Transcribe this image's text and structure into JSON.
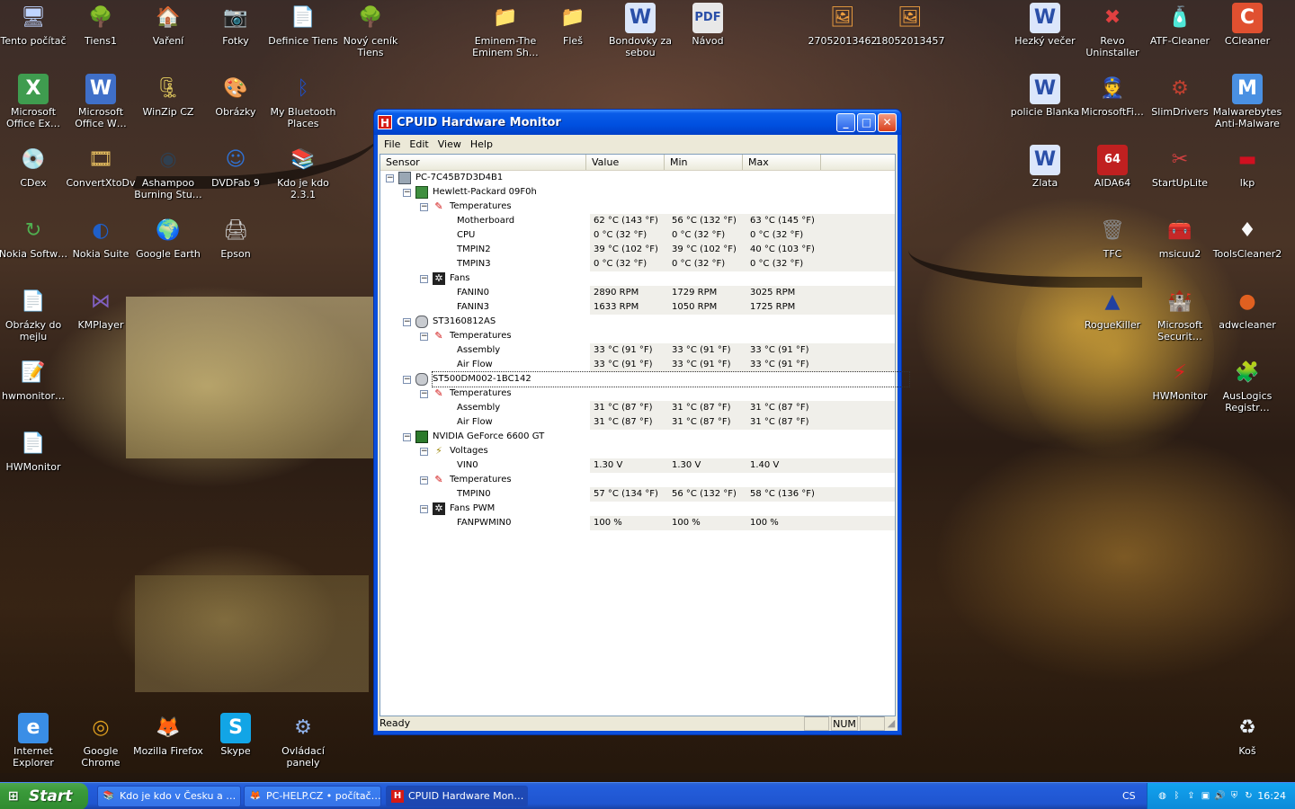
{
  "desktop": {
    "icons": [
      {
        "label": "Tento počítač",
        "icon": "computer-icon",
        "glyph": "🖥",
        "color": "#bfd4ff"
      },
      {
        "label": "Tiens1",
        "icon": "tree-icon",
        "glyph": "🌳",
        "color": "#3ea53e"
      },
      {
        "label": "Vaření",
        "icon": "home-folder-icon",
        "glyph": "🏠",
        "color": "#e8d7a0"
      },
      {
        "label": "Fotky",
        "icon": "camera-icon",
        "glyph": "📷",
        "color": "#c8c8c8"
      },
      {
        "label": "Definice Tiens",
        "icon": "document-icon",
        "glyph": "📄",
        "color": "#f2f2f2"
      },
      {
        "label": "Nový ceník Tiens",
        "icon": "tree-icon",
        "glyph": "🌳",
        "color": "#3ea53e"
      },
      {
        "label": "Eminem-The Eminem Sh…",
        "icon": "folder-icon",
        "glyph": "📁",
        "color": "#f3d370"
      },
      {
        "label": "Fleš",
        "icon": "folder-icon",
        "glyph": "📁",
        "color": "#f3d370"
      },
      {
        "label": "Bondovky za sebou",
        "icon": "word-document-icon",
        "glyph": "W",
        "color": "#dbe6fb"
      },
      {
        "label": "Návod",
        "icon": "pdf-icon",
        "glyph": "PDF",
        "color": "#e8e8e8"
      },
      {
        "label": "27052013462",
        "icon": "image-file-icon",
        "glyph": "🖼",
        "color": "#f0a040"
      },
      {
        "label": "18052013457",
        "icon": "image-file-icon",
        "glyph": "🖼",
        "color": "#f0a040"
      },
      {
        "label": "Hezký večer",
        "icon": "word-document-icon",
        "glyph": "W",
        "color": "#dbe6fb"
      },
      {
        "label": "Revo Uninstaller",
        "icon": "revo-uninstaller-icon",
        "glyph": "✖",
        "color": "#e04040"
      },
      {
        "label": "ATF-Cleaner",
        "icon": "atf-cleaner-icon",
        "glyph": "🧴",
        "color": "#8fb8f0"
      },
      {
        "label": "CCleaner",
        "icon": "ccleaner-icon",
        "glyph": "C",
        "color": "#e05030"
      },
      {
        "label": "Microsoft Office Ex…",
        "icon": "excel-icon",
        "glyph": "X",
        "color": "#3f9c4f"
      },
      {
        "label": "Microsoft Office W…",
        "icon": "word-icon",
        "glyph": "W",
        "color": "#3f6fc8"
      },
      {
        "label": "WinZip CZ",
        "icon": "winzip-icon",
        "glyph": "🗜",
        "color": "#e8d060"
      },
      {
        "label": "Obrázky",
        "icon": "pictures-icon",
        "glyph": "🎨",
        "color": "#d060c0"
      },
      {
        "label": "My Bluetooth Places",
        "icon": "bluetooth-icon",
        "glyph": "ᛒ",
        "color": "#1f4fc8"
      },
      {
        "label": "policie Blanka",
        "icon": "word-document-icon",
        "glyph": "W",
        "color": "#dbe6fb"
      },
      {
        "label": "MicrosoftFi…",
        "icon": "microsoft-fix-icon",
        "glyph": "👮",
        "color": "#4060a0"
      },
      {
        "label": "SlimDrivers",
        "icon": "slimdrivers-icon",
        "glyph": "⚙",
        "color": "#c04030"
      },
      {
        "label": "Malwarebytes Anti-Malware",
        "icon": "malwarebytes-icon",
        "glyph": "M",
        "color": "#4a90e2"
      },
      {
        "label": "CDex",
        "icon": "cdex-icon",
        "glyph": "💿",
        "color": "#c03030"
      },
      {
        "label": "ConvertXtoDv",
        "icon": "convertxtodvd-icon",
        "glyph": "🎞",
        "color": "#e8c060"
      },
      {
        "label": "Ashampoo Burning Stu…",
        "icon": "ashampoo-icon",
        "glyph": "◉",
        "color": "#304050"
      },
      {
        "label": "DVDFab 9",
        "icon": "dvdfab-icon",
        "glyph": "☺",
        "color": "#3070d0"
      },
      {
        "label": "Kdo je kdo 2.3.1",
        "icon": "books-icon",
        "glyph": "📚",
        "color": "#7050a0"
      },
      {
        "label": "Zlata",
        "icon": "word-document-icon",
        "glyph": "W",
        "color": "#dbe6fb"
      },
      {
        "label": "AIDA64",
        "icon": "aida64-icon",
        "glyph": "64",
        "color": "#c02020"
      },
      {
        "label": "StartUpLite",
        "icon": "startuplite-icon",
        "glyph": "✂",
        "color": "#d04040"
      },
      {
        "label": "lkp",
        "icon": "lkp-icon",
        "glyph": "▬",
        "color": "#d01020"
      },
      {
        "label": "Nokia Softw…",
        "icon": "nokia-software-icon",
        "glyph": "↻",
        "color": "#50b050"
      },
      {
        "label": "Nokia Suite",
        "icon": "nokia-suite-icon",
        "glyph": "◐",
        "color": "#1f5fc8"
      },
      {
        "label": "Google Earth",
        "icon": "google-earth-icon",
        "glyph": "🌍",
        "color": "#2a70d0"
      },
      {
        "label": "Epson",
        "icon": "printer-icon",
        "glyph": "🖨",
        "color": "#c8c8c8"
      },
      {
        "label": "TFC",
        "icon": "trash-can-icon",
        "glyph": "🗑",
        "color": "#888888"
      },
      {
        "label": "msicuu2",
        "icon": "msicuu-icon",
        "glyph": "🧰",
        "color": "#e0c060"
      },
      {
        "label": "ToolsCleaner2",
        "icon": "playing-card-icon",
        "glyph": "♦",
        "color": "#f8f8f8"
      },
      {
        "label": "Obrázky do mejlu",
        "icon": "document-icon",
        "glyph": "📄",
        "color": "#f2f2f2"
      },
      {
        "label": "KMPlayer",
        "icon": "kmplayer-icon",
        "glyph": "⋈",
        "color": "#8060c0"
      },
      {
        "label": "RogueKiller",
        "icon": "roguekiller-icon",
        "glyph": "▲",
        "color": "#2040a0"
      },
      {
        "label": "Microsoft Securit…",
        "icon": "microsoft-security-icon",
        "glyph": "🏰",
        "color": "#2060c0"
      },
      {
        "label": "adwcleaner",
        "icon": "adwcleaner-icon",
        "glyph": "●",
        "color": "#e06020"
      },
      {
        "label": "hwmonitor…",
        "icon": "text-file-icon",
        "glyph": "📝",
        "color": "#f2f2f2"
      },
      {
        "label": "HWMonitor",
        "icon": "hwmonitor-icon",
        "glyph": "⚡",
        "color": "#e02020"
      },
      {
        "label": "AusLogics Registr…",
        "icon": "auslogics-icon",
        "glyph": "🧩",
        "color": "#60b040"
      },
      {
        "label": "HWMonitor",
        "icon": "text-file-icon",
        "glyph": "📄",
        "color": "#f2f2f2"
      },
      {
        "label": "Internet Explorer",
        "icon": "internet-explorer-icon",
        "glyph": "e",
        "color": "#3a8ee6"
      },
      {
        "label": "Google Chrome",
        "icon": "chrome-icon",
        "glyph": "◎",
        "color": "#e0a020"
      },
      {
        "label": "Mozilla Firefox",
        "icon": "firefox-icon",
        "glyph": "🦊",
        "color": "#e86a20"
      },
      {
        "label": "Skype",
        "icon": "skype-icon",
        "glyph": "S",
        "color": "#12a5e6"
      },
      {
        "label": "Ovládací panely",
        "icon": "control-panel-icon",
        "glyph": "⚙",
        "color": "#8fb0e8"
      },
      {
        "label": "Koš",
        "icon": "recycle-bin-icon",
        "glyph": "♻",
        "color": "#e8f0f8"
      }
    ]
  },
  "window": {
    "title": "CPUID Hardware Monitor",
    "app_icon": "H",
    "menu": [
      "File",
      "Edit",
      "View",
      "Help"
    ],
    "columns": [
      "Sensor",
      "Value",
      "Min",
      "Max"
    ],
    "rows": [
      {
        "name": "PC-7C45B7D3D4B1",
        "level": 0,
        "icon": "computer-icon",
        "expander": "−"
      },
      {
        "name": "Hewlett-Packard 09F0h",
        "level": 1,
        "icon": "motherboard-icon",
        "expander": "−"
      },
      {
        "name": "Temperatures",
        "level": 2,
        "icon": "thermometer-icon",
        "expander": "−"
      },
      {
        "name": "Motherboard",
        "level": 3,
        "value": "62 °C (143 °F)",
        "min": "56 °C (132 °F)",
        "max": "63 °C (145 °F)"
      },
      {
        "name": "CPU",
        "level": 3,
        "value": "0 °C (32 °F)",
        "min": "0 °C (32 °F)",
        "max": "0 °C (32 °F)"
      },
      {
        "name": "TMPIN2",
        "level": 3,
        "value": "39 °C (102 °F)",
        "min": "39 °C (102 °F)",
        "max": "40 °C (103 °F)"
      },
      {
        "name": "TMPIN3",
        "level": 3,
        "value": "0 °C (32 °F)",
        "min": "0 °C (32 °F)",
        "max": "0 °C (32 °F)"
      },
      {
        "name": "Fans",
        "level": 2,
        "icon": "fan-icon",
        "expander": "−"
      },
      {
        "name": "FANIN0",
        "level": 3,
        "value": "2890 RPM",
        "min": "1729 RPM",
        "max": "3025 RPM"
      },
      {
        "name": "FANIN3",
        "level": 3,
        "value": "1633 RPM",
        "min": "1050 RPM",
        "max": "1725 RPM"
      },
      {
        "name": "ST3160812AS",
        "level": 1,
        "icon": "hard-disk-icon",
        "expander": "−"
      },
      {
        "name": "Temperatures",
        "level": 2,
        "icon": "thermometer-icon",
        "expander": "−"
      },
      {
        "name": "Assembly",
        "level": 3,
        "value": "33 °C (91 °F)",
        "min": "33 °C (91 °F)",
        "max": "33 °C (91 °F)"
      },
      {
        "name": "Air Flow",
        "level": 3,
        "value": "33 °C (91 °F)",
        "min": "33 °C (91 °F)",
        "max": "33 °C (91 °F)"
      },
      {
        "name": "ST500DM002-1BC142",
        "level": 1,
        "icon": "hard-disk-icon",
        "expander": "−",
        "selected": true
      },
      {
        "name": "Temperatures",
        "level": 2,
        "icon": "thermometer-icon",
        "expander": "−"
      },
      {
        "name": "Assembly",
        "level": 3,
        "value": "31 °C (87 °F)",
        "min": "31 °C (87 °F)",
        "max": "31 °C (87 °F)"
      },
      {
        "name": "Air Flow",
        "level": 3,
        "value": "31 °C (87 °F)",
        "min": "31 °C (87 °F)",
        "max": "31 °C (87 °F)"
      },
      {
        "name": "NVIDIA GeForce 6600 GT",
        "level": 1,
        "icon": "graphics-card-icon",
        "expander": "−"
      },
      {
        "name": "Voltages",
        "level": 2,
        "icon": "voltage-icon",
        "expander": "−"
      },
      {
        "name": "VIN0",
        "level": 3,
        "value": "1.30 V",
        "min": "1.30 V",
        "max": "1.40 V"
      },
      {
        "name": "Temperatures",
        "level": 2,
        "icon": "thermometer-icon",
        "expander": "−"
      },
      {
        "name": "TMPIN0",
        "level": 3,
        "value": "57 °C (134 °F)",
        "min": "56 °C (132 °F)",
        "max": "58 °C (136 °F)"
      },
      {
        "name": "Fans PWM",
        "level": 2,
        "icon": "fan-icon",
        "expander": "−"
      },
      {
        "name": "FANPWMIN0",
        "level": 3,
        "value": "100 %",
        "min": "100 %",
        "max": "100 %"
      }
    ],
    "status": "Ready",
    "status_num": "NUM"
  },
  "taskbar": {
    "start_label": "Start",
    "tasks": [
      {
        "label": "Kdo je kdo v Česku a …",
        "icon": "books-icon",
        "active": false
      },
      {
        "label": "PC-HELP.CZ • počítač…",
        "icon": "firefox-icon",
        "active": false
      },
      {
        "label": "CPUID Hardware Mon…",
        "icon": "hwmonitor-icon",
        "active": true
      }
    ],
    "language": "CS",
    "clock": "16:24"
  }
}
